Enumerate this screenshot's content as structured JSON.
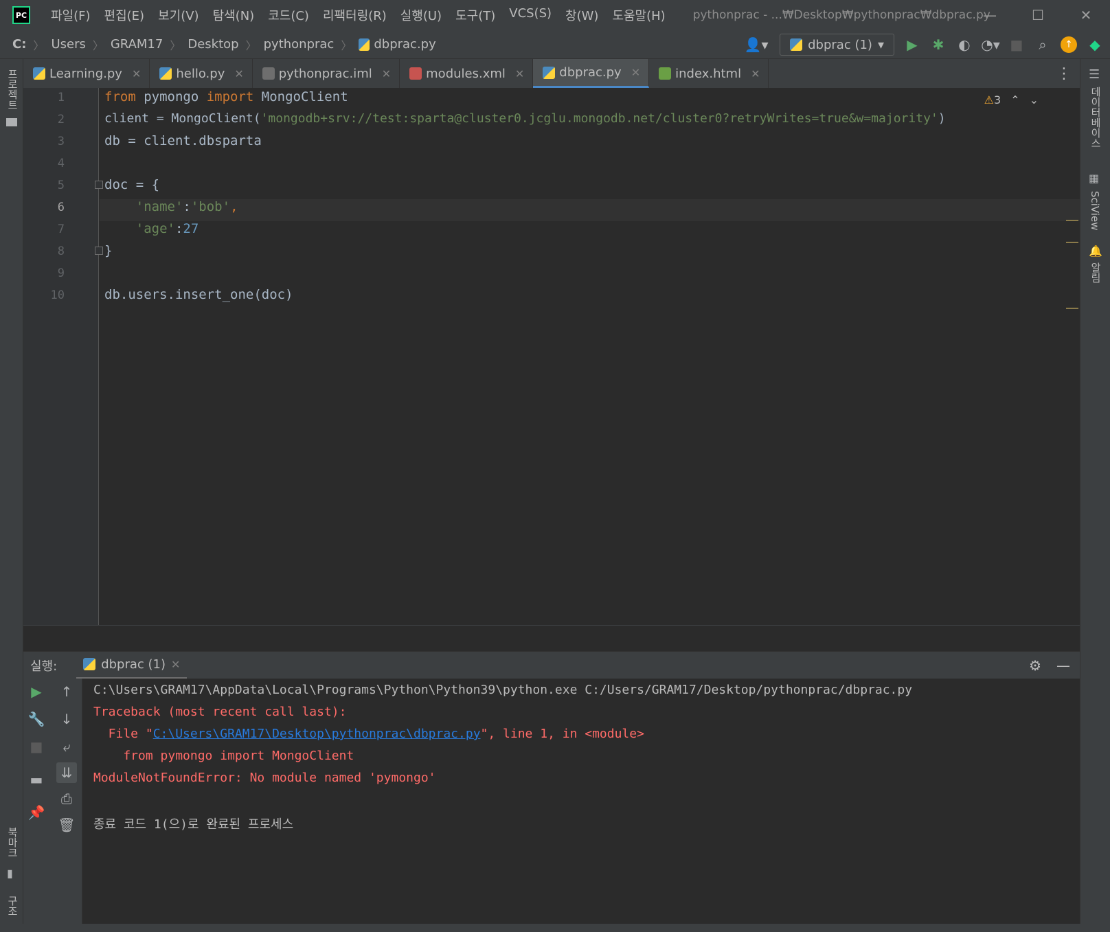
{
  "titlebar": {
    "menu": [
      "파일(F)",
      "편집(E)",
      "보기(V)",
      "탐색(N)",
      "코드(C)",
      "리팩터링(R)",
      "실행(U)",
      "도구(T)",
      "VCS(S)",
      "창(W)",
      "도움말(H)"
    ],
    "window_title": "pythonprac - ...₩Desktop₩pythonprac₩dbprac.py"
  },
  "navbar": {
    "breadcrumbs": [
      "C:",
      "Users",
      "GRAM17",
      "Desktop",
      "pythonprac",
      "dbprac.py"
    ],
    "run_config": "dbprac (1)"
  },
  "tabs": [
    {
      "label": "Learning.py",
      "type": "py"
    },
    {
      "label": "hello.py",
      "type": "py"
    },
    {
      "label": "pythonprac.iml",
      "type": "iml"
    },
    {
      "label": "modules.xml",
      "type": "xml"
    },
    {
      "label": "dbprac.py",
      "type": "py",
      "active": true
    },
    {
      "label": "index.html",
      "type": "html"
    }
  ],
  "editor": {
    "warning_count": "3",
    "current_line": 6,
    "line_numbers": [
      "1",
      "2",
      "3",
      "4",
      "5",
      "6",
      "7",
      "8",
      "9",
      "10"
    ],
    "lines": {
      "l1_kw1": "from",
      "l1_mod": " pymongo ",
      "l1_kw2": "import",
      "l1_name": " MongoClient",
      "l2_pre": "client = MongoClient(",
      "l2_str": "'mongodb+srv://test:sparta@cluster0.jcglu.mongodb.net/cluster0?retryWrites=true&w=majority'",
      "l2_post": ")",
      "l3": "db = client.dbsparta",
      "l5": "doc = {",
      "l6_str1": "'name'",
      "l6_colon": ":",
      "l6_str2": "'bob'",
      "l6_comma": ",",
      "l7_str": "'age'",
      "l7_colon": ":",
      "l7_num": "27",
      "l8": "}",
      "l10": "db.users.insert_one(doc)"
    }
  },
  "side": {
    "left_top": "프로젝트",
    "left_bottom_1": "북마크",
    "left_bottom_2": "구조",
    "right_1": "데이터베이스",
    "right_2": "SciView",
    "right_3": "알림"
  },
  "run_panel": {
    "label": "실행:",
    "tab": "dbprac (1)",
    "console": {
      "cmd": "C:\\Users\\GRAM17\\AppData\\Local\\Programs\\Python\\Python39\\python.exe C:/Users/GRAM17/Desktop/pythonprac/dbprac.py",
      "traceback": "Traceback (most recent call last):",
      "file_pre": "  File \"",
      "file_link": "C:\\Users\\GRAM17\\Desktop\\pythonprac\\dbprac.py",
      "file_post": "\", line 1, in <module>",
      "code": "    from pymongo import MongoClient",
      "error": "ModuleNotFoundError: No module named 'pymongo'",
      "exit": "종료 코드 1(으)로 완료된 프로세스"
    }
  },
  "colors": {
    "bg": "#2b2b2b",
    "keyword": "#cc7832",
    "string": "#6a8759",
    "number": "#6897bb",
    "error": "#ff6b68",
    "link": "#287bde"
  }
}
